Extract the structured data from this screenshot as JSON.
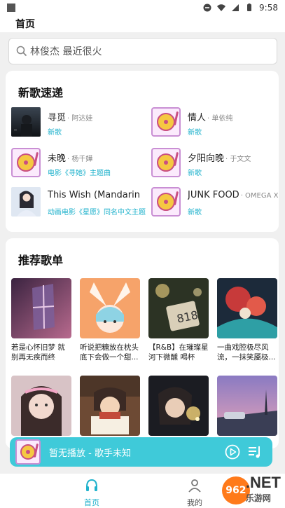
{
  "status_bar": {
    "time": "9:58"
  },
  "header": {
    "title": "首页"
  },
  "search": {
    "placeholder": "林俊杰 最近很火"
  },
  "new_songs": {
    "title": "新歌速递",
    "items": [
      {
        "name": "寻觅",
        "artist": "· 阿达娃",
        "sub": "新歌",
        "thumb": "photo-dark"
      },
      {
        "name": "情人",
        "artist": "· 单依纯",
        "sub": "新歌",
        "thumb": "vinyl"
      },
      {
        "name": "未晚",
        "artist": "· 杨千嬅",
        "sub": "电影《寻她》主题曲",
        "thumb": "vinyl"
      },
      {
        "name": "夕阳向晚",
        "artist": "· 于文文",
        "sub": "新歌",
        "thumb": "vinyl"
      },
      {
        "name": "This Wish (Mandarin S...",
        "artist": "",
        "sub": "动画电影《星愿》同名中文主题",
        "thumb": "photo-girl"
      },
      {
        "name": "JUNK FOOD",
        "artist": "· OMEGA X",
        "sub": "新歌",
        "thumb": "vinyl"
      }
    ]
  },
  "recommended": {
    "title": "推荐歌单",
    "playlists": [
      {
        "title": "若是心怀旧梦 就别再无疾而终"
      },
      {
        "title": "听说把糖放在枕头底下会做一个甜..."
      },
      {
        "title": "【R&B】在璀璨星河下微醺 喝杯小..."
      },
      {
        "title": "一曲戏腔极尽风流，一抹笑靥极..."
      },
      {
        "title": ""
      },
      {
        "title": ""
      },
      {
        "title": ""
      },
      {
        "title": ""
      }
    ]
  },
  "player": {
    "text": "暂无播放 - 歌手未知"
  },
  "tabbar": {
    "home_label": "首页",
    "mine_label": "我的"
  },
  "watermark": {
    "circle": "962",
    "net": ".NET",
    "sub": "乐游网"
  },
  "colors": {
    "accent": "#3fcad9",
    "tab_active": "#1fb2cc",
    "sub_text": "#1fb2cc"
  }
}
